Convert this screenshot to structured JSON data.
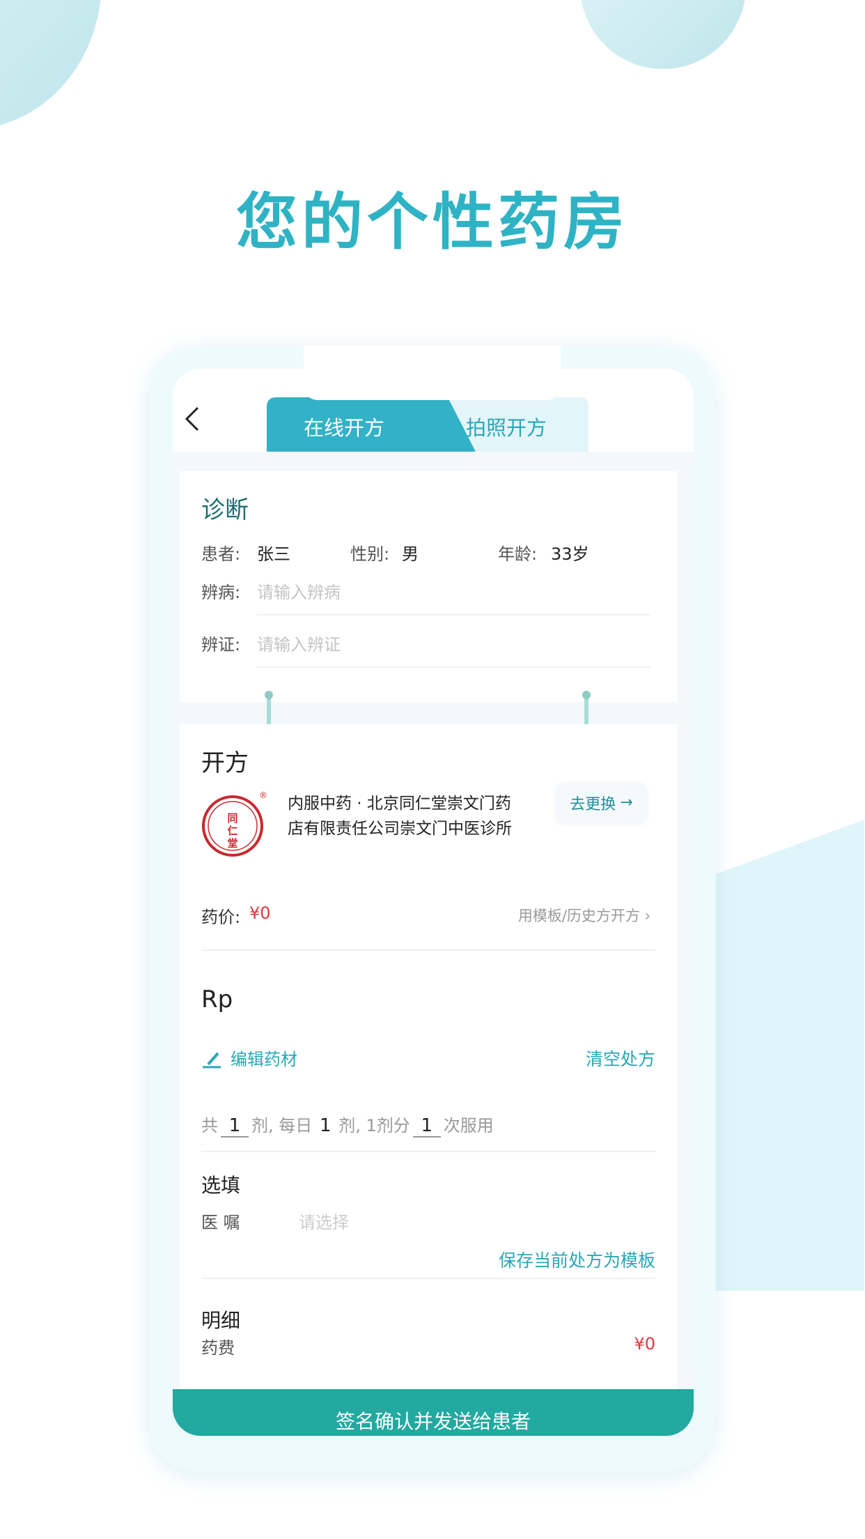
{
  "headline": "您的个性药房",
  "tabs": [
    {
      "label": "在线开方",
      "active": true
    },
    {
      "label": "拍照开方",
      "active": false
    }
  ],
  "diagnosis": {
    "title": "诊断",
    "patient_label": "患者:",
    "patient_value": "张三",
    "gender_label": "性别:",
    "gender_value": "男",
    "age_label": "年龄:",
    "age_value": "33岁",
    "disease_label": "辨病:",
    "disease_placeholder": "请输入辨病",
    "syndrome_label": "辨证:",
    "syndrome_placeholder": "请输入辨证"
  },
  "prescription": {
    "title": "开方",
    "pharmacy_line1": "内服中药 · 北京同仁堂崇文门药",
    "pharmacy_line2": "店有限责任公司崇文门中医诊所",
    "logo_text": "同仁堂",
    "change_button": "去更换",
    "price_label": "药价:",
    "price_value": "¥0",
    "template_link": "用模板/历史方开方",
    "rp": "Rp",
    "edit_herbs": "编辑药材",
    "clear": "清空处方",
    "dosage": {
      "p1": "共",
      "total": "1",
      "p2": "剂, 每日",
      "daily": "1",
      "p3": "剂, 1剂分",
      "times": "1",
      "p4": "次服用"
    },
    "optional_title": "选填",
    "advice_label": "医 嘱",
    "advice_placeholder": "请选择",
    "save_template": "保存当前处方为模板",
    "detail_title": "明细",
    "fee_label": "药费",
    "fee_value": "¥0"
  },
  "submit_button": "签名确认并发送给患者",
  "colors": {
    "accent": "#2fb3c4",
    "button": "#22a9a0",
    "price": "#e0383e"
  }
}
